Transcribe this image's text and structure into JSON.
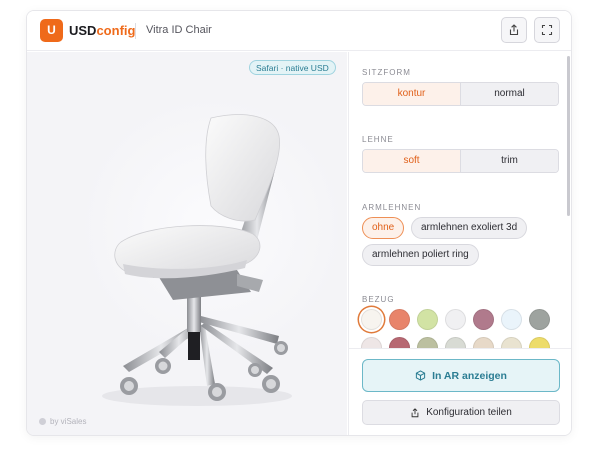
{
  "header": {
    "logo_letter": "U",
    "brand_prefix": "USD",
    "brand_suffix": "config",
    "product_name": "Vitra ID Chair",
    "share_icon": "share-icon",
    "fullscreen_icon": "fullscreen-icon"
  },
  "viewer": {
    "engine_badge": "Safari · native USD",
    "credit": "by viSales"
  },
  "config": {
    "sitzform": {
      "label": "SITZFORM",
      "options": [
        "kontur",
        "normal"
      ],
      "selected": "kontur"
    },
    "lehne": {
      "label": "LEHNE",
      "options": [
        "soft",
        "trim"
      ],
      "selected": "soft"
    },
    "armlehnen": {
      "label": "ARMLEHNEN",
      "options": [
        "ohne",
        "armlehnen exoliert 3d",
        "armlehnen poliert ring"
      ],
      "selected": "ohne"
    },
    "bezug": {
      "label": "BEZUG",
      "swatches": [
        "#f7f4ef",
        "#e8846a",
        "#d2e3a4",
        "#f0f0f2",
        "#b07a8c",
        "#eaf4fb",
        "#9ea39f",
        "#eee6e6",
        "#b76872",
        "#bcc0a0",
        "#d8dbd4",
        "#e7d9c8",
        "#e9e3d0",
        "#eddc6a"
      ],
      "selected_index": 0
    }
  },
  "actions": {
    "ar_label": "In AR anzeigen",
    "share_label": "Konfiguration teilen"
  },
  "colors": {
    "accent": "#ef6a1a",
    "teal": "#2b7d93"
  }
}
